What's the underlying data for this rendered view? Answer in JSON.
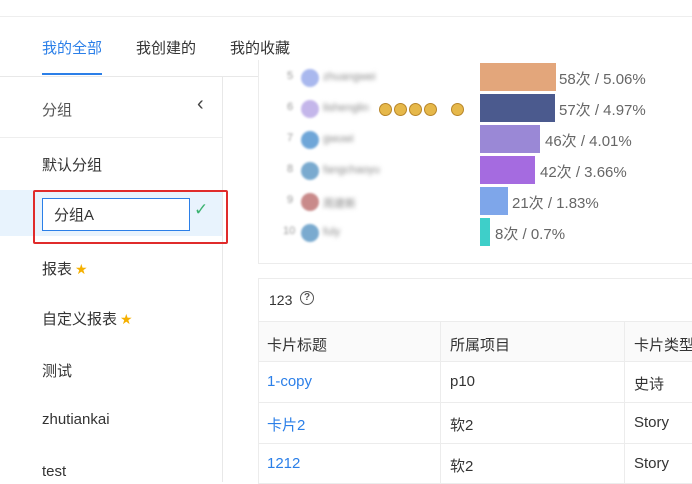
{
  "tabs": [
    {
      "label": "我的全部",
      "active": true
    },
    {
      "label": "我创建的",
      "active": false
    },
    {
      "label": "我的收藏",
      "active": false
    }
  ],
  "sidebar": {
    "title": "分组",
    "collapse_icon": "chevron-left-icon",
    "items": [
      {
        "label": "默认分组",
        "starred": false
      },
      {
        "label": "报表",
        "starred": true
      },
      {
        "label": "自定义报表",
        "starred": true
      },
      {
        "label": "测试",
        "starred": false
      },
      {
        "label": "zhutiankai",
        "starred": false
      },
      {
        "label": "test",
        "starred": false
      }
    ],
    "editing": {
      "value": "分组A",
      "confirm_icon": "check-icon"
    },
    "highlight_color": "#e02b2b"
  },
  "ranking": {
    "rows": [
      {
        "rank": "5",
        "name": "zhuangwei",
        "label": "58次 / 5.06%",
        "count": 58,
        "percent": 5.06,
        "color": "#e3a67b"
      },
      {
        "rank": "6",
        "name": "lishenglin",
        "label": "57次 / 4.97%",
        "count": 57,
        "percent": 4.97,
        "color": "#4b5a8e"
      },
      {
        "rank": "7",
        "name": "gwuwi",
        "label": "46次 / 4.01%",
        "count": 46,
        "percent": 4.01,
        "color": "#9a88d6"
      },
      {
        "rank": "8",
        "name": "fangchaoyu",
        "label": "42次 / 3.66%",
        "count": 42,
        "percent": 3.66,
        "color": "#a56be0"
      },
      {
        "rank": "9",
        "name": "周建新",
        "label": "21次 / 1.83%",
        "count": 21,
        "percent": 1.83,
        "color": "#7ea6ea"
      },
      {
        "rank": "10",
        "name": "fuly",
        "label": "8次 / 0.7%",
        "count": 8,
        "percent": 0.7,
        "color": "#3ecfc9"
      }
    ]
  },
  "table": {
    "title": "123",
    "help_icon": "question-circle-icon",
    "columns": [
      "卡片标题",
      "所属项目",
      "卡片类型"
    ],
    "rows": [
      [
        "1-copy",
        "p10",
        "史诗"
      ],
      [
        "卡片2",
        "软2",
        "Story"
      ],
      [
        "1212",
        "软2",
        "Story"
      ]
    ]
  },
  "colors": {
    "accent": "#2b7fe8",
    "star": "#f5b000",
    "confirm": "#3cb371"
  }
}
